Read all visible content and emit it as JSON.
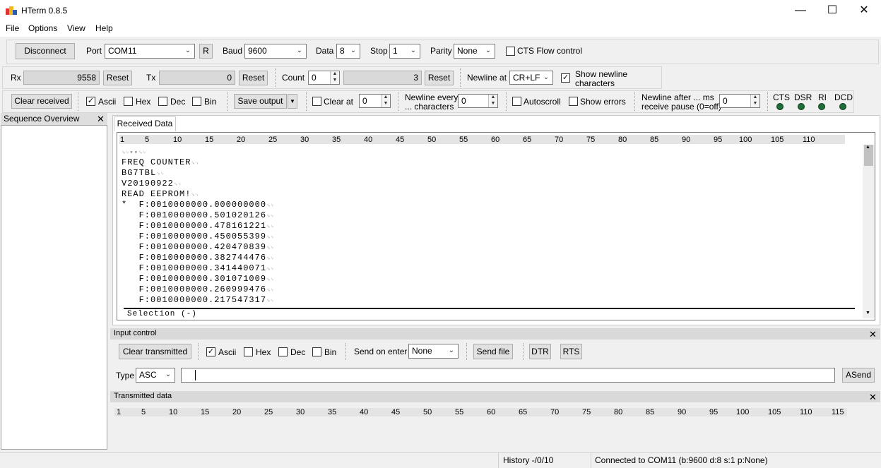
{
  "window": {
    "title": "HTerm 0.8.5",
    "minimize": "—",
    "maximize": "☐",
    "close": "✕"
  },
  "menu": [
    "File",
    "Options",
    "View",
    "Help"
  ],
  "connection": {
    "disconnect_label": "Disconnect",
    "port_label": "Port",
    "port_value": "COM11",
    "refresh_label": "R",
    "baud_label": "Baud",
    "baud_value": "9600",
    "data_label": "Data",
    "data_value": "8",
    "stop_label": "Stop",
    "stop_value": "1",
    "parity_label": "Parity",
    "parity_value": "None",
    "cts_flow_label": "CTS Flow control"
  },
  "counters": {
    "rx_label": "Rx",
    "rx_value": "9558",
    "rx_reset": "Reset",
    "tx_label": "Tx",
    "tx_value": "0",
    "tx_reset": "Reset",
    "count_label": "Count",
    "count_value": "0",
    "count_display": "3",
    "count_reset": "Reset",
    "newline_at_label": "Newline at",
    "newline_at_value": "CR+LF",
    "show_newline_label_1": "Show newline",
    "show_newline_label_2": "characters"
  },
  "receive_toolbar": {
    "clear_received": "Clear received",
    "ascii": "Ascii",
    "hex": "Hex",
    "dec": "Dec",
    "bin": "Bin",
    "save_output": "Save output",
    "clear_at_label": "Clear at",
    "clear_at_value": "0",
    "newline_every_1": "Newline every",
    "newline_every_2": "... characters",
    "newline_every_value": "0",
    "autoscroll": "Autoscroll",
    "show_errors": "Show errors",
    "newline_after_1": "Newline after ... ms",
    "newline_after_2": "receive pause (0=off)",
    "newline_after_value": "0",
    "signals": [
      "CTS",
      "DSR",
      "RI",
      "DCD"
    ]
  },
  "sidebar": {
    "title": "Sequence Overview",
    "close": "✕"
  },
  "received": {
    "tab": "Received Data",
    "ruler": [
      "1",
      "5",
      "10",
      "15",
      "20",
      "25",
      "30",
      "35",
      "40",
      "45",
      "50",
      "55",
      "60",
      "65",
      "70",
      "75",
      "80",
      "85",
      "90",
      "95",
      "100",
      "105",
      "110"
    ],
    "lines": [
      "",
      "FREQ COUNTER",
      "BG7TBL",
      "V20190922",
      "READ EEPROM!",
      "*  F:0010000000.000000000",
      "   F:0010000000.501020126",
      "   F:0010000000.478161221",
      "   F:0010000000.450055399",
      "   F:0010000000.420470839",
      "   F:0010000000.382744476",
      "   F:0010000000.341440071",
      "   F:0010000000.301071009",
      "   F:0010000000.260999476",
      "   F:0010000000.217547317"
    ],
    "selection": "Selection (-)"
  },
  "input_control": {
    "title": "Input control",
    "close": "✕",
    "clear_transmitted": "Clear transmitted",
    "ascii": "Ascii",
    "hex": "Hex",
    "dec": "Dec",
    "bin": "Bin",
    "send_on_enter_label": "Send on enter",
    "send_on_enter_value": "None",
    "send_file": "Send file",
    "dtr": "DTR",
    "rts": "RTS",
    "type_label": "Type",
    "type_value": "ASC",
    "input_value": "",
    "asend": "ASend"
  },
  "transmitted": {
    "title": "Transmitted data",
    "close": "✕",
    "ruler": [
      "1",
      "5",
      "10",
      "15",
      "20",
      "25",
      "30",
      "35",
      "40",
      "45",
      "50",
      "55",
      "60",
      "65",
      "70",
      "75",
      "80",
      "85",
      "90",
      "95",
      "100",
      "105",
      "110",
      "115"
    ]
  },
  "status": {
    "history": "History -/0/10",
    "connection": "Connected to COM11 (b:9600 d:8 s:1 p:None)"
  }
}
